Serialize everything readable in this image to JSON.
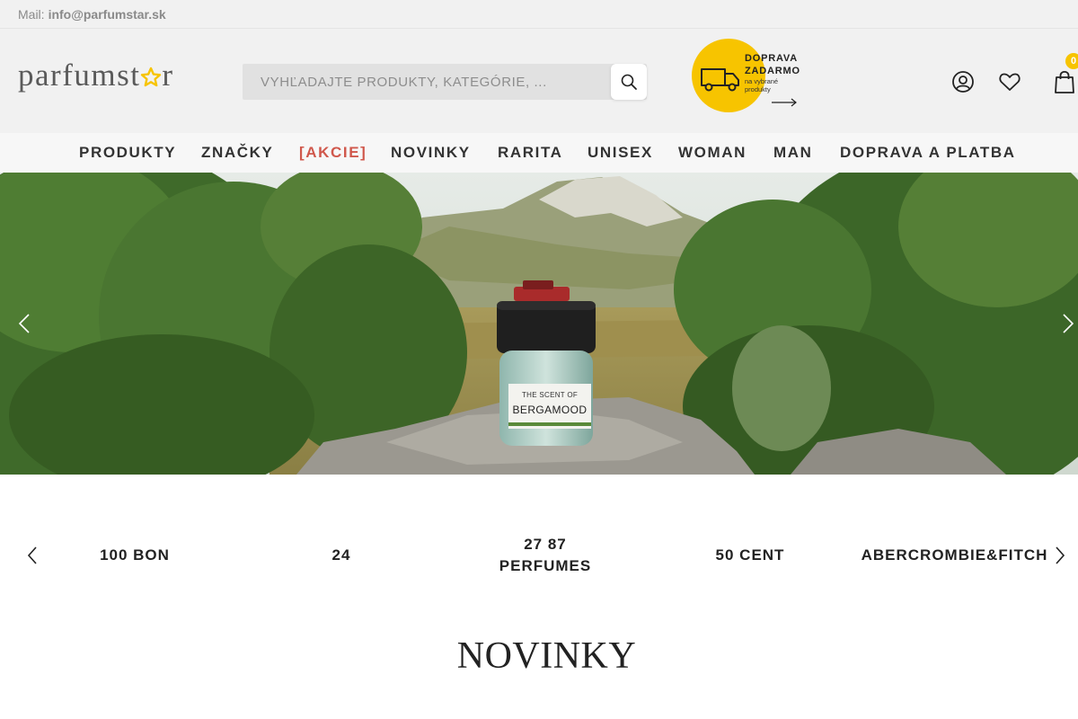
{
  "topbar": {
    "mail_label": "Mail:",
    "mail_value": "info@parfumstar.sk"
  },
  "header": {
    "logo_text": "parfumst",
    "logo_text_end": "r",
    "search_placeholder": "VYHĽADAJTE PRODUKTY, KATEGÓRIE, ...",
    "delivery_title": "DOPRAVA ZADARMO",
    "delivery_sub": "na vybrané produkty",
    "cart_count": "0",
    "accent_color": "#f7c400"
  },
  "nav": {
    "items": [
      {
        "label": "PRODUKTY"
      },
      {
        "label": "ZNAČKY"
      },
      {
        "label": "[AKCIE]"
      },
      {
        "label": "NOVINKY"
      },
      {
        "label": "RARITA"
      },
      {
        "label": "UNISEX"
      },
      {
        "label": "WOMAN"
      },
      {
        "label": "MAN"
      },
      {
        "label": "DOPRAVA A PLATBA"
      }
    ],
    "sale_color": "#d0584c"
  },
  "hero": {
    "bottle_line1": "THE SCENT OF",
    "bottle_line2": "BERGAMOOD"
  },
  "brands": {
    "items": [
      {
        "label": "100 BON"
      },
      {
        "label": "24"
      },
      {
        "label": "27 87 PERFUMES"
      },
      {
        "label": "50 CENT"
      },
      {
        "label": "ABERCROMBIE&FITCH"
      }
    ]
  },
  "sections": {
    "novinky_title": "NOVINKY"
  }
}
